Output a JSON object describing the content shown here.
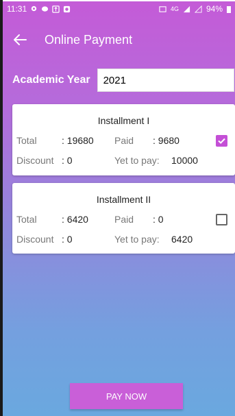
{
  "status_bar": {
    "time": "11:31",
    "network": "4G",
    "battery": "94%"
  },
  "app_bar": {
    "title": "Online Payment",
    "back_icon": "arrow-left-icon"
  },
  "academic_year": {
    "label": "Academic Year",
    "value": "2021"
  },
  "installments": [
    {
      "title": "Installment I",
      "total_label": "Total",
      "total_value": ": 19680",
      "paid_label": "Paid",
      "paid_value": ": 9680",
      "discount_label": "Discount",
      "discount_value": ": 0",
      "yet_label": "Yet to pay:",
      "yet_value": "10000",
      "checked": true
    },
    {
      "title": "Installment II",
      "total_label": "Total",
      "total_value": ": 6420",
      "paid_label": "Paid",
      "paid_value": ": 0",
      "discount_label": "Discount",
      "discount_value": ": 0",
      "yet_label": "Yet to pay:",
      "yet_value": "6420",
      "checked": false
    }
  ],
  "pay_button": {
    "label": "PAY NOW"
  },
  "colors": {
    "accent": "#c44fd6",
    "button": "#c95fd8",
    "gradient_top": "#c45bd7",
    "gradient_bottom": "#6aa8df"
  }
}
